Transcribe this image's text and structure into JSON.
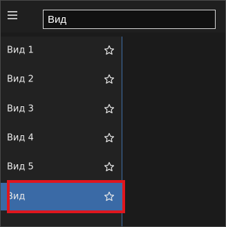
{
  "header": {
    "search": {
      "value": "Вид"
    }
  },
  "sidebar": {
    "items": [
      {
        "label": "Вид 1"
      },
      {
        "label": "Вид 2"
      },
      {
        "label": "Вид 3"
      },
      {
        "label": "Вид 4"
      },
      {
        "label": "Вид 5"
      },
      {
        "label": "Вид"
      }
    ],
    "selected_index": 5
  },
  "colors": {
    "background": "#1b1b1b",
    "sidebar_bg": "#222222",
    "active_bg": "#3a6aa6",
    "accent_border": "#3e6ea8",
    "highlight": "#e0161e",
    "text": "#e9e9e9"
  },
  "icons": {
    "menu": "hamburger-icon",
    "favorite": "star-outline-icon"
  }
}
